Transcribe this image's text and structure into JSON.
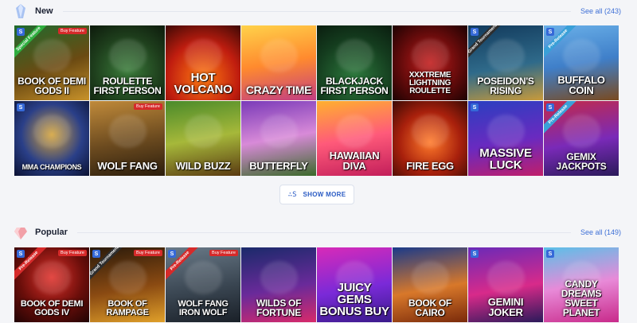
{
  "sections": {
    "new": {
      "title": "New",
      "see_all": "See all (243)",
      "icon": "crystal-icon",
      "tiles": [
        {
          "title": "Book of Demi Gods II",
          "bg": "linear-gradient(160deg,#1f6b2e,#6b4a12 55%,#c8922a)",
          "size": 12,
          "badge": "S",
          "ribbon": "Special Feature",
          "ribbon_color": "#2fae3f",
          "buy": "Buy Feature"
        },
        {
          "title": "Roulette First Person",
          "bg": "radial-gradient(circle at 50% 60%,#3a7b3a,#1d3c1b 60%,#0d1a0c)",
          "size": 12
        },
        {
          "title": "Hot Volcano",
          "bg": "radial-gradient(circle at 50% 70%,#ff7a12,#c01d0f 55%,#3d0905)",
          "size": 15
        },
        {
          "title": "Crazy Time",
          "bg": "linear-gradient(170deg,#ffd24a,#ff8a2e 50%,#c23e84)",
          "size": 14
        },
        {
          "title": "Blackjack First Person",
          "bg": "radial-gradient(circle at 50% 70%,#2d7a3d,#143c1e 60%,#0a1d0f)",
          "size": 12
        },
        {
          "title": "XXXtreme Lightning Roulette",
          "bg": "radial-gradient(circle at 50% 50%,#c21b1b,#5e0a0a 60%,#1d0202)",
          "size": 10
        },
        {
          "title": "Poseidon's Rising",
          "bg": "linear-gradient(170deg,#123a5c,#2f6a8a 55%,#c89a3b)",
          "size": 12,
          "badge": "S",
          "ribbon": "Grand Tournament",
          "ribbon_color": "#2e2e2e"
        },
        {
          "title": "Buffalo Coin",
          "bg": "linear-gradient(170deg,#6ab0e8,#3f7fc9 50%,#7a4a1f)",
          "size": 13,
          "badge": "S",
          "ribbon": "Pre-Release",
          "ribbon_color": "#3aa0d8"
        },
        {
          "title": "MMA Champions",
          "bg": "radial-gradient(circle at 50% 45%,#d4a33a,#2a3f88 55%,#0b1233)",
          "size": 9,
          "badge": "S"
        },
        {
          "title": "Wolf Fang",
          "bg": "linear-gradient(170deg,#c08a3a,#6b4a1f 55%,#2b1d0c)",
          "size": 13,
          "buy": "Buy Feature"
        },
        {
          "title": "Wild Buzz",
          "bg": "linear-gradient(170deg,#4a8a2a,#a6b83a 50%,#5a3a12)",
          "size": 13
        },
        {
          "title": "Butterfly",
          "bg": "linear-gradient(170deg,#7a3ab8,#d88ad8 50%,#3a6a2a)",
          "size": 13
        },
        {
          "title": "Hawaiian Diva",
          "bg": "linear-gradient(170deg,#ffb02e,#ff5a7a 50%,#c21e5a)",
          "size": 13
        },
        {
          "title": "Fire Egg",
          "bg": "radial-gradient(circle at 50% 55%,#ff7a2a,#a8200c 55%,#3a0a04)",
          "size": 13
        },
        {
          "title": "Massive Luck",
          "bg": "linear-gradient(170deg,#2a3fc0,#6a2ac0 55%,#c01e6a)",
          "size": 15,
          "badge": "S"
        },
        {
          "title": "Gemix Jackpots",
          "bg": "linear-gradient(170deg,#c22a4a,#7a2ab8 55%,#2a1a5a)",
          "size": 12,
          "badge": "S",
          "ribbon": "Pre-Release",
          "ribbon_color": "#3aa0d8"
        }
      ]
    },
    "show_more": {
      "label": "SHOW MORE",
      "icon": "show-more-icon"
    },
    "popular": {
      "title": "Popular",
      "see_all": "See all (149)",
      "icon": "gem-icon",
      "tiles": [
        {
          "title": "Book of Demi Gods IV",
          "bg": "radial-gradient(circle at 50% 40%,#e0302a,#6a0e0a 55%,#200303)",
          "size": 11,
          "badge": "S",
          "ribbon": "Pre-Release",
          "ribbon_color": "#d62a2a",
          "buy": "Buy Feature"
        },
        {
          "title": "Book of Rampage",
          "bg": "linear-gradient(170deg,#2a1a0a,#8a4a12 55%,#e0a02a)",
          "size": 11,
          "badge": "S",
          "ribbon": "Grand Tournament",
          "ribbon_color": "#2e2e2e",
          "buy": "Buy Feature"
        },
        {
          "title": "Wolf Fang Iron Wolf",
          "bg": "linear-gradient(170deg,#6a7a88,#3a4652 55%,#1a2028)",
          "size": 11,
          "badge": "S",
          "ribbon": "Pre-Release",
          "ribbon_color": "#d62a2a",
          "buy": "Buy Feature"
        },
        {
          "title": "Wilds of Fortune",
          "bg": "linear-gradient(170deg,#1a2a6a,#6a2a9a 55%,#d82a6a)",
          "size": 12
        },
        {
          "title": "Juicy Gems Bonus Buy",
          "bg": "linear-gradient(170deg,#d82ab8,#7a2ad8 55%,#3a1a8a)",
          "size": 15
        },
        {
          "title": "Book of Cairo",
          "bg": "linear-gradient(170deg,#1a3a8a,#d8782a 55%,#7a2a0a)",
          "size": 12
        },
        {
          "title": "Gemini Joker",
          "bg": "linear-gradient(170deg,#6a2ab8,#d82a8a 55%,#2a1a5a)",
          "size": 13,
          "badge": "S"
        },
        {
          "title": "Candy Dreams Sweet Planet",
          "bg": "linear-gradient(170deg,#5ac0e8,#e88ad8 50%,#c82a8a)",
          "size": 12,
          "badge": "S"
        }
      ]
    }
  }
}
